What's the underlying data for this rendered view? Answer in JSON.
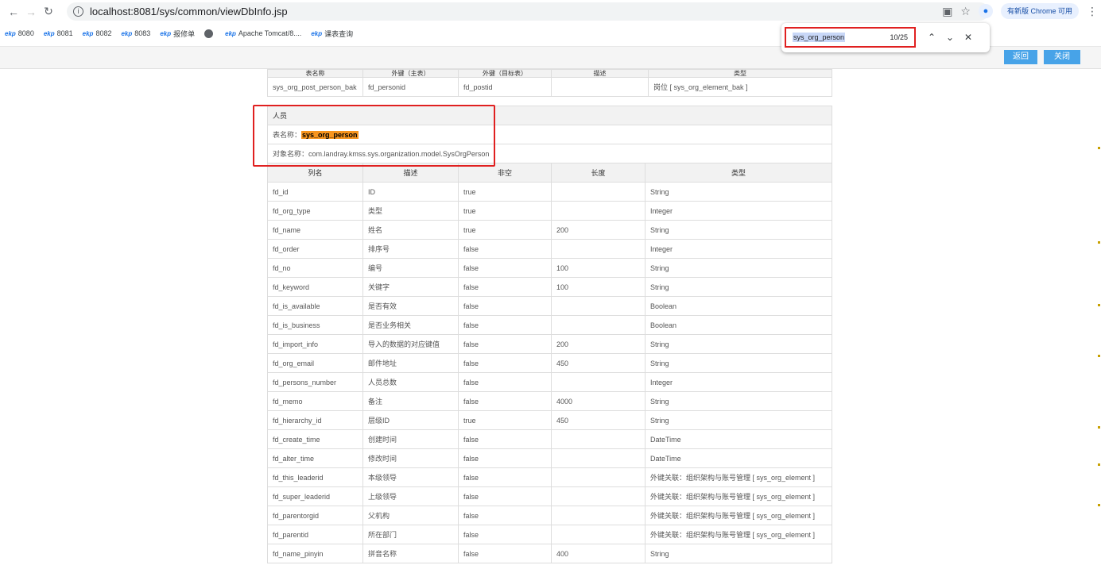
{
  "browser": {
    "url": "localhost:8081/sys/common/viewDbInfo.jsp",
    "update_label": "有新版 Chrome 可用",
    "bookmarks": [
      "8080",
      "8081",
      "8082",
      "8083",
      "报修单",
      "Apache Tomcat/8....",
      "课表查询"
    ]
  },
  "find": {
    "query": "sys_org_person",
    "count": "10/25"
  },
  "toolbar": {
    "back_label": "返回",
    "close_label": "关闭"
  },
  "prev_table": {
    "header": [
      "表名称",
      "外键（主表）",
      "外键（目标表）",
      "描述",
      "类型"
    ],
    "row": [
      "sys_org_post_person_bak",
      "fd_personid",
      "fd_postid",
      "",
      "岗位 [ sys_org_element_bak ]"
    ]
  },
  "section": {
    "title": "人员",
    "table_name_label": "表名称：",
    "table_name": "sys_org_person",
    "object_name_label": "对象名称：",
    "object_name": "com.landray.kmss.sys.organization.model.SysOrgPerson"
  },
  "columns": [
    "列名",
    "描述",
    "非空",
    "长度",
    "类型"
  ],
  "rows": [
    [
      "fd_id",
      "ID",
      "true",
      "",
      "String"
    ],
    [
      "fd_org_type",
      "类型",
      "true",
      "",
      "Integer"
    ],
    [
      "fd_name",
      "姓名",
      "true",
      "200",
      "String"
    ],
    [
      "fd_order",
      "排序号",
      "false",
      "",
      "Integer"
    ],
    [
      "fd_no",
      "编号",
      "false",
      "100",
      "String"
    ],
    [
      "fd_keyword",
      "关键字",
      "false",
      "100",
      "String"
    ],
    [
      "fd_is_available",
      "是否有效",
      "false",
      "",
      "Boolean"
    ],
    [
      "fd_is_business",
      "是否业务相关",
      "false",
      "",
      "Boolean"
    ],
    [
      "fd_import_info",
      "导入的数据的对应键值",
      "false",
      "200",
      "String"
    ],
    [
      "fd_org_email",
      "邮件地址",
      "false",
      "450",
      "String"
    ],
    [
      "fd_persons_number",
      "人员总数",
      "false",
      "",
      "Integer"
    ],
    [
      "fd_memo",
      "备注",
      "false",
      "4000",
      "String"
    ],
    [
      "fd_hierarchy_id",
      "层级ID",
      "true",
      "450",
      "String"
    ],
    [
      "fd_create_time",
      "创建时间",
      "false",
      "",
      "DateTime"
    ],
    [
      "fd_alter_time",
      "修改时间",
      "false",
      "",
      "DateTime"
    ],
    [
      "fd_this_leaderid",
      "本级领导",
      "false",
      "",
      "外键关联：组织架构与账号管理 [ sys_org_element ]"
    ],
    [
      "fd_super_leaderid",
      "上级领导",
      "false",
      "",
      "外键关联：组织架构与账号管理 [ sys_org_element ]"
    ],
    [
      "fd_parentorgid",
      "父机构",
      "false",
      "",
      "外键关联：组织架构与账号管理 [ sys_org_element ]"
    ],
    [
      "fd_parentid",
      "所在部门",
      "false",
      "",
      "外键关联：组织架构与账号管理 [ sys_org_element ]"
    ],
    [
      "fd_name_pinyin",
      "拼音名称",
      "false",
      "400",
      "String"
    ]
  ]
}
